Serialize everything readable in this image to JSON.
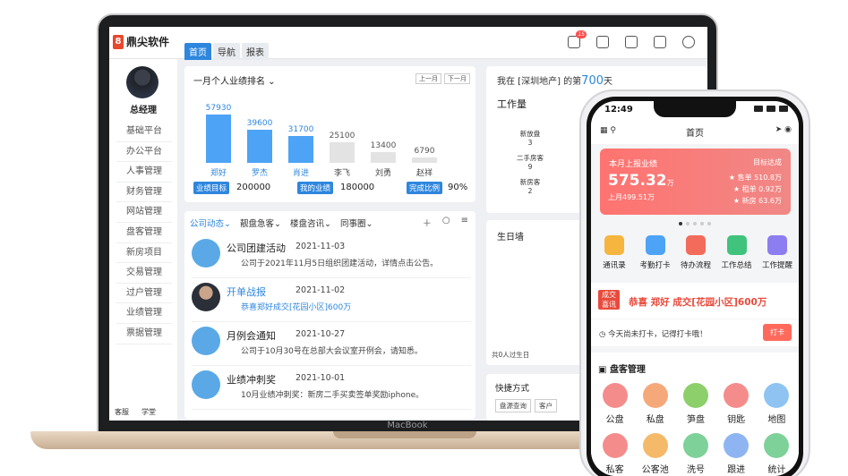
{
  "desktop": {
    "logo": "鼎尖软件",
    "nav_tabs": [
      "首页",
      "导航",
      "报表"
    ],
    "notification_count": "15",
    "user_role": "总经理",
    "menu": [
      "基础平台",
      "办公平台",
      "人事管理",
      "财务管理",
      "网站管理",
      "盘客管理",
      "新房项目",
      "交易管理",
      "过户管理",
      "业绩管理",
      "票据管理"
    ],
    "sidebar_footer": [
      "客服",
      "学堂"
    ],
    "ranking": {
      "title": "一月个人业绩排名",
      "prev": "上一月",
      "next": "下一月",
      "stats": [
        {
          "label": "业绩目标",
          "value": "200000"
        },
        {
          "label": "我的业绩",
          "value": "180000"
        },
        {
          "label": "完成比例",
          "value": "90%"
        }
      ]
    },
    "feed_tabs": [
      "公司动态",
      "靓盘急客",
      "楼盘咨讯",
      "同事圈"
    ],
    "feed": [
      {
        "title": "公司团建活动",
        "date": "2021-11-03",
        "desc": "公司于2021年11月5日组织团建活动，详情点击公告。"
      },
      {
        "title": "开单战报",
        "date": "2021-11-02",
        "desc": "恭喜郑好成交[花园小区]600万"
      },
      {
        "title": "月例会通知",
        "date": "2021-10-27",
        "desc": "公司于10月30号在总部大会议室开例会，请知悉。"
      },
      {
        "title": "业绩冲刺奖",
        "date": "2021-10-01",
        "desc": "10月业绩冲刺奖：新房二手买卖签单奖励iphone。"
      }
    ],
    "tenure": {
      "prefix": "我在 [深圳地产] 的第",
      "days": "700",
      "suffix": "天"
    },
    "workload_title": "工作量",
    "workload": [
      {
        "label": "新放盘",
        "value": "3"
      },
      {
        "label": "二手房客",
        "value": "9"
      },
      {
        "label": "新房客",
        "value": "2"
      }
    ],
    "birthday_title": "生日墙",
    "birthday_foot": "共0人过生日",
    "shortcuts_title": "快捷方式",
    "shortcuts": [
      "盘源查询",
      "客户"
    ],
    "laptop_label": "MacBook"
  },
  "mobile": {
    "time": "12:49",
    "title": "首页",
    "report": {
      "label": "本月上报业绩",
      "target_label": "目标达成",
      "amount": "575.32",
      "amount_unit": "万",
      "prev": "上月499.51万",
      "rows": [
        "★ 售单 510.8万",
        "★ 租单 0.92万",
        "★ 新房 63.6万"
      ]
    },
    "quick": [
      "通讯录",
      "考勤打卡",
      "待办流程",
      "工作总结",
      "工作提醒"
    ],
    "deal": {
      "tag1": "成交",
      "tag2": "喜讯",
      "text": "恭喜 郑好 成交[花园小区]600万"
    },
    "clock_text": "今天尚未打卡，记得打卡哦！",
    "clock_button": "打卡",
    "manager_title": "盘客管理",
    "manager_items": [
      "公盘",
      "私盘",
      "笋盘",
      "钥匙",
      "地图",
      "私客",
      "公客池",
      "洗号",
      "跟进",
      "统计"
    ]
  },
  "chart_data": {
    "type": "bar",
    "title": "一月个人业绩排名",
    "categories": [
      "郑好",
      "罗杰",
      "肖进",
      "李飞",
      "刘勇",
      "赵祥"
    ],
    "values": [
      57930,
      39600,
      31700,
      25100,
      13400,
      6790
    ],
    "highlighted": [
      true,
      true,
      true,
      false,
      false,
      false
    ],
    "colors": {
      "highlight": "#4da3f5",
      "muted": "#e3e3e3"
    }
  }
}
